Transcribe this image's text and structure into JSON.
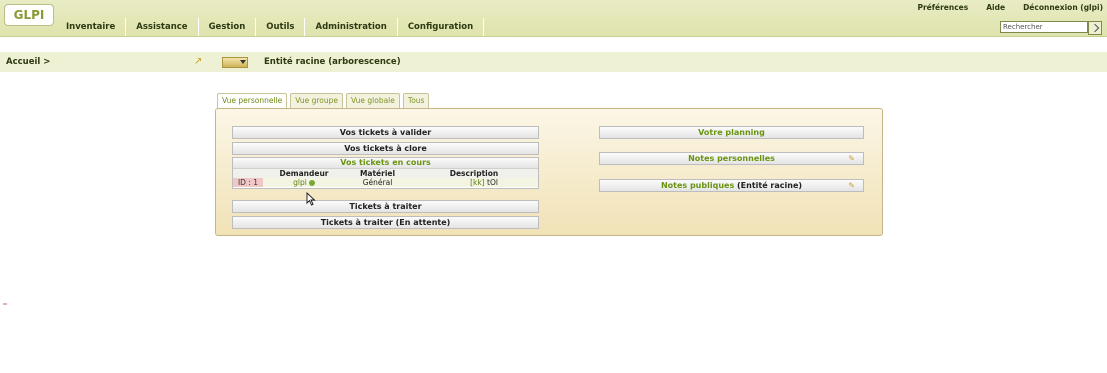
{
  "header": {
    "logo_text": "GLPI",
    "menu": [
      "Inventaire",
      "Assistance",
      "Gestion",
      "Outils",
      "Administration",
      "Configuration"
    ],
    "links": [
      "Préférences",
      "Aide",
      "Déconnexion (glpi)"
    ],
    "search_placeholder": "Rechercher"
  },
  "breadcrumb": {
    "home": "Accueil >",
    "entity": "Entité racine (arborescence)"
  },
  "tabs": [
    "Vue personnelle",
    "Vue groupe",
    "Vue globale",
    "Tous"
  ],
  "active_tab": "Vue personnelle",
  "left_column": {
    "to_validate": "Vos tickets à valider",
    "to_close": "Vos tickets à clore",
    "in_progress": {
      "title": "Vos tickets en cours",
      "columns": [
        "",
        "Demandeur",
        "Matériel",
        "Description"
      ],
      "row": {
        "id": "ID : 1",
        "requester": "glpi",
        "material": "Général",
        "description_link": "[kk]",
        "description_text": "tOl"
      }
    },
    "to_process": "Tickets à traiter",
    "waiting": "Tickets à traiter (En attente)"
  },
  "right_column": {
    "planning": "Votre planning",
    "personal_notes": "Notes personnelles",
    "public_notes_label": "Notes publiques",
    "public_notes_entity": "(Entité racine)"
  },
  "colors": {
    "accent": "#6a9410",
    "menu_bg": "#dfe3ac",
    "panel_bg": "#f1e2b6"
  },
  "icons": [
    "pin-icon",
    "add-note-icon",
    "user-icon",
    "cursor-icon"
  ]
}
